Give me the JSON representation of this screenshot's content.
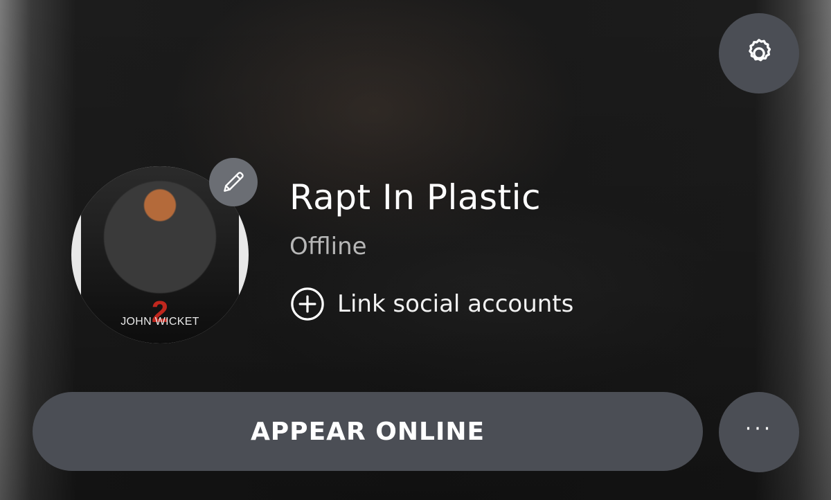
{
  "profile": {
    "gamertag": "Rapt In Plastic",
    "status": "Offline",
    "link_social_label": "Link social accounts"
  },
  "avatar": {
    "poster_title": "JOHN WICKET",
    "poster_number": "2"
  },
  "actions": {
    "appear_online_label": "APPEAR ONLINE",
    "more_label": "···"
  },
  "icons": {
    "settings": "gear-icon",
    "edit": "pencil-icon",
    "link": "plus-circle-icon",
    "more": "ellipsis-icon"
  },
  "colors": {
    "button_bg": "#4b4e55",
    "edit_bg": "#6b6e74",
    "text_primary": "#ffffff",
    "text_secondary": "#b7b7b7"
  }
}
